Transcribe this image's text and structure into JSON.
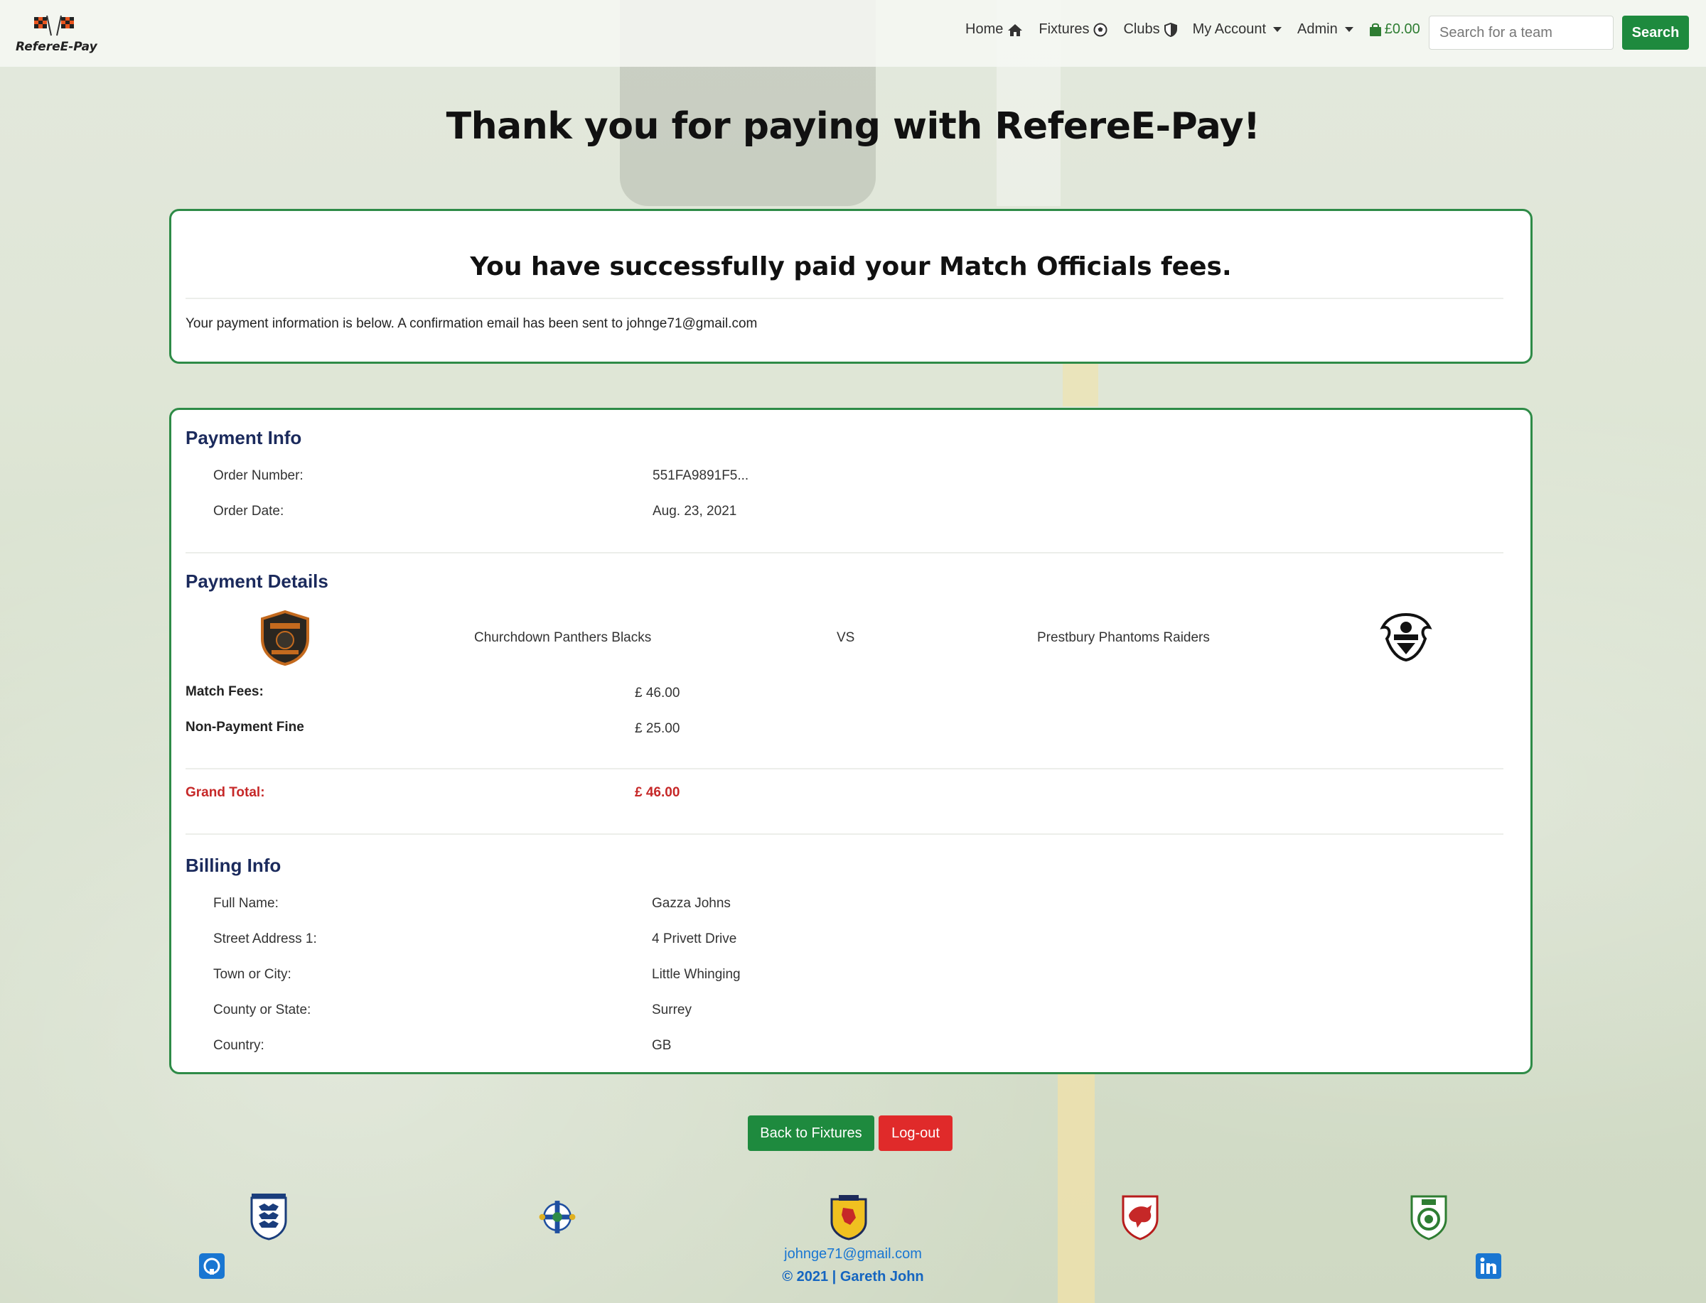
{
  "brand": {
    "name": "RefereE-Pay"
  },
  "nav": {
    "home": "Home",
    "fixtures": "Fixtures",
    "clubs": "Clubs",
    "my_account": "My Account",
    "admin": "Admin",
    "cart_total": "£0.00",
    "search_placeholder": "Search for a team",
    "search_button": "Search"
  },
  "page": {
    "title": "Thank you for paying with RefereE-Pay!",
    "success_heading": "You have successfully paid your Match Officials fees.",
    "info_text": "Your payment information is below. A confirmation email has been sent to johnge71@gmail.com"
  },
  "payment_info": {
    "title": "Payment Info",
    "rows": [
      {
        "label": "Order Number:",
        "value": "551FA9891F5..."
      },
      {
        "label": "Order Date:",
        "value": "Aug. 23, 2021"
      }
    ]
  },
  "payment_details": {
    "title": "Payment Details",
    "home_team": "Churchdown Panthers Blacks",
    "vs": "VS",
    "away_team": "Prestbury Phantoms Raiders",
    "fees": [
      {
        "label": "Match Fees:",
        "value": "£ 46.00"
      },
      {
        "label": "Non-Payment Fine",
        "value": "£ 25.00"
      }
    ],
    "grand_total_label": "Grand Total:",
    "grand_total_value": "£ 46.00"
  },
  "billing_info": {
    "title": "Billing Info",
    "rows": [
      {
        "label": "Full Name:",
        "value": "Gazza Johns"
      },
      {
        "label": "Street Address 1:",
        "value": "4 Privett Drive"
      },
      {
        "label": "Town or City:",
        "value": "Little Whinging"
      },
      {
        "label": "County or State:",
        "value": "Surrey"
      },
      {
        "label": "Country:",
        "value": "GB"
      }
    ]
  },
  "actions": {
    "back": "Back to Fixtures",
    "logout": "Log-out"
  },
  "footer": {
    "email": "johnge71@gmail.com",
    "copyright": "© 2021 | Gareth John"
  },
  "colors": {
    "accent_green": "#1e8a3e",
    "danger_red": "#e02a2a",
    "card_border": "#2e8b47",
    "heading_navy": "#1b2a5c"
  }
}
